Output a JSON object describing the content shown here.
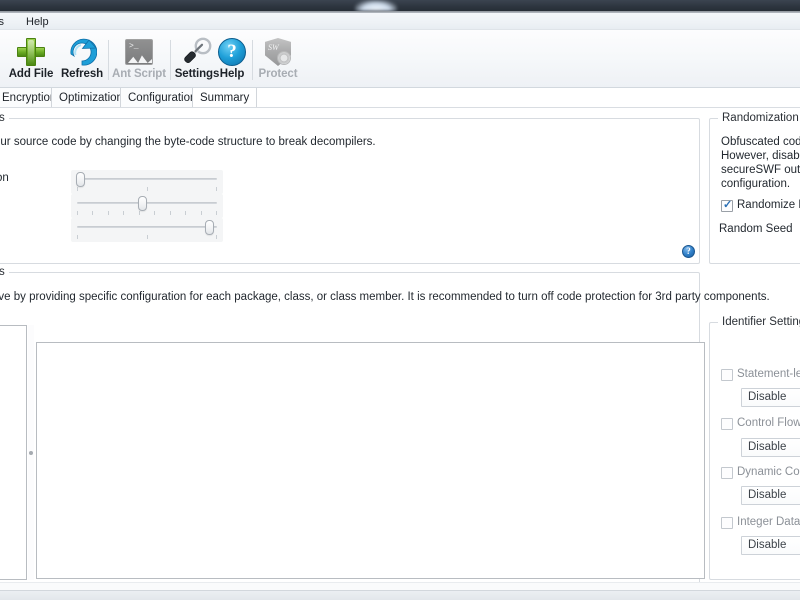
{
  "window": {
    "title_bar_visible_fragment": ""
  },
  "menu": {
    "items": [
      {
        "label": "ls",
        "name": "menu-tools"
      },
      {
        "label": "Help",
        "name": "menu-help"
      }
    ]
  },
  "toolbar": {
    "buttons": [
      {
        "label": "Add File",
        "icon": "plus-icon",
        "enabled": true
      },
      {
        "label": "Refresh",
        "icon": "refresh-icon",
        "enabled": true
      },
      {
        "label": "Ant Script",
        "icon": "ant-script-icon",
        "enabled": false
      },
      {
        "label": "Settings",
        "icon": "wrench-icon",
        "enabled": true
      },
      {
        "label": "Help",
        "icon": "question-icon",
        "enabled": true
      },
      {
        "label": "Protect",
        "icon": "shield-icon",
        "enabled": false
      }
    ]
  },
  "tabs": [
    {
      "label": "Encryption",
      "active": false
    },
    {
      "label": "Optimization",
      "active": false
    },
    {
      "label": "Configurations",
      "active": false
    },
    {
      "label": "Summary",
      "active": true
    }
  ],
  "code_protection": {
    "legend": "s",
    "description": "our source code by changing the byte-code structure to break decompilers.",
    "field_label": "on",
    "sliders": [
      {
        "name": "slider-top",
        "position_pct": 0,
        "ticks": 3
      },
      {
        "name": "slider-middle",
        "position_pct": 50,
        "ticks": 10
      },
      {
        "name": "slider-bottom",
        "position_pct": 100,
        "ticks": 3
      }
    ],
    "help_glyph": "?"
  },
  "randomization": {
    "legend": "Randomization",
    "description_lines": [
      "Obfuscated code w",
      "However, disabling",
      "secureSWF output",
      "configuration."
    ],
    "checkbox": {
      "label": "Randomize Res",
      "checked": true
    },
    "seed_label": "Random Seed"
  },
  "member_settings": {
    "legend": "s",
    "description": "ove by providing specific configuration for each package, class, or class member. It is recommended to turn off code protection for 3rd party components."
  },
  "identifier_settings": {
    "legend": "Identifier Settings",
    "options": [
      {
        "label": "Statement-leve",
        "checked": false,
        "value": "Disable"
      },
      {
        "label": "Control Flow O",
        "checked": false,
        "value": "Disable"
      },
      {
        "label": "Dynamic Code",
        "checked": false,
        "value": "Disable"
      },
      {
        "label": "Integer Data Ob",
        "checked": false,
        "value": "Disable"
      }
    ]
  },
  "colors": {
    "accent_blue": "#2f7fc8",
    "plus_green": "#69aa23",
    "refresh_blue": "#1e9fd8",
    "panel_border": "#d7dbe0",
    "text": "#232930",
    "disabled_text": "#a8adb3"
  }
}
